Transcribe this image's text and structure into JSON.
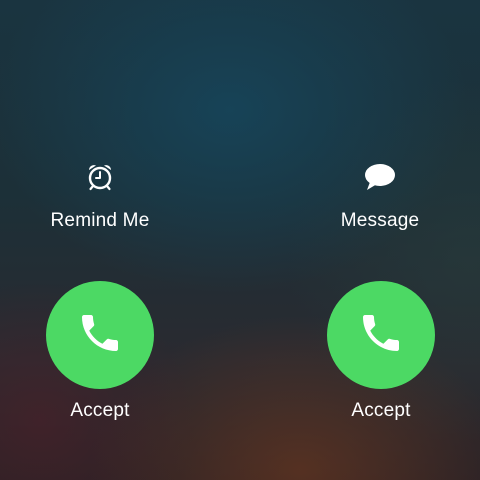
{
  "quick_actions": {
    "remind": {
      "label": "Remind Me",
      "icon": "alarm-clock-icon"
    },
    "message": {
      "label": "Message",
      "icon": "speech-bubble-icon"
    }
  },
  "accept_buttons": [
    {
      "label": "Accept",
      "icon": "phone-icon",
      "color": "#4cd964"
    },
    {
      "label": "Accept",
      "icon": "phone-icon",
      "color": "#4cd964"
    }
  ]
}
